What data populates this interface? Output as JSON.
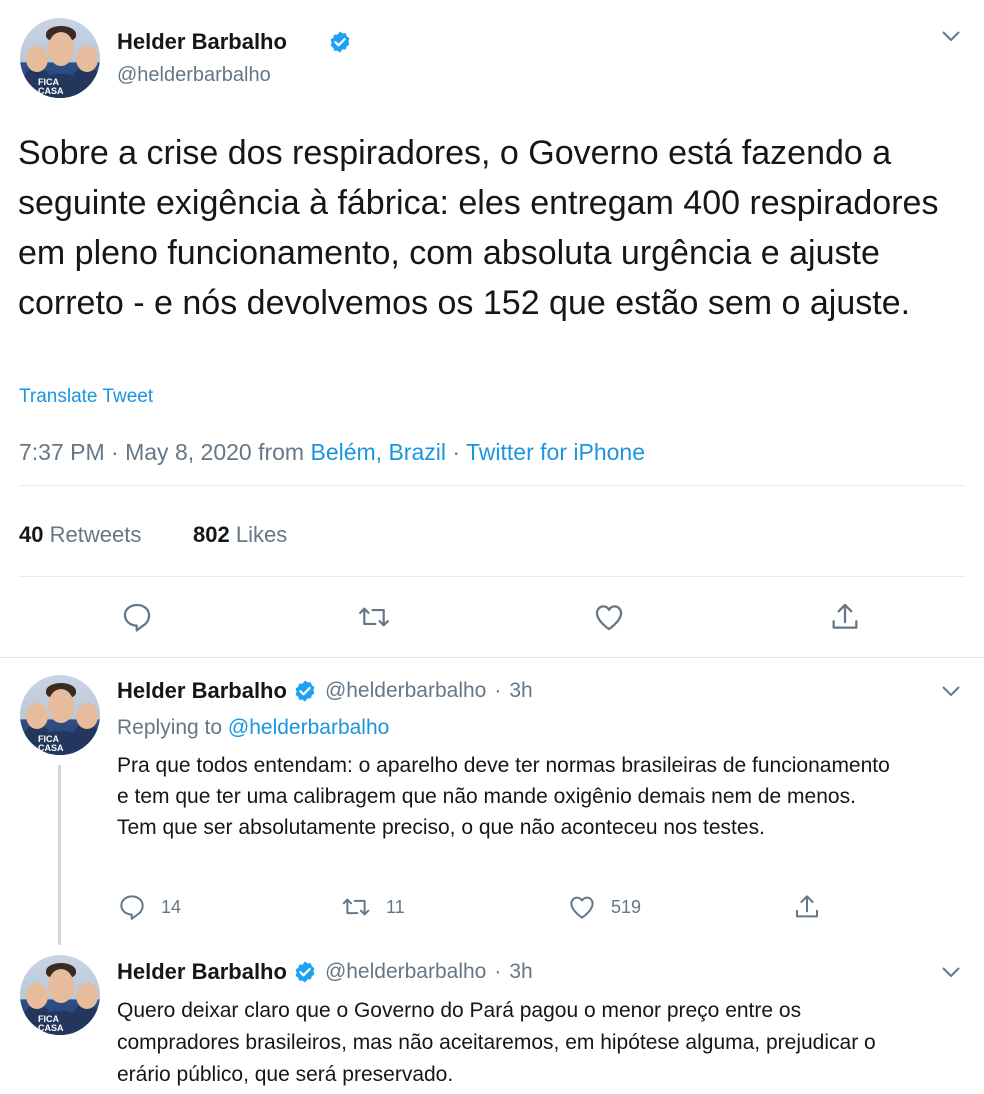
{
  "main_tweet": {
    "author_name": "Helder Barbalho",
    "author_handle": "@helderbarbalho",
    "avatar_text": "FICA CASA",
    "text": "Sobre a crise dos respiradores, o Governo está fazendo a seguinte exigência à fábrica: eles entregam 400 respiradores em pleno funcionamento, com absoluta urgência e ajuste correto - e nós devolvemos os 152 que estão sem o ajuste.",
    "translate_label": "Translate Tweet",
    "time": "7:37 PM",
    "sep1": "·",
    "date": "May 8, 2020",
    "from_label": "from",
    "location": "Belém, Brazil",
    "sep2": "·",
    "source": "Twitter for iPhone",
    "retweets_count": "40",
    "retweets_label": "Retweets",
    "likes_count": "802",
    "likes_label": "Likes"
  },
  "replies": [
    {
      "author_name": "Helder Barbalho",
      "author_handle": "@helderbarbalho",
      "sep": "·",
      "time": "3h",
      "replying_label": "Replying to",
      "replying_handle": "@helderbarbalho",
      "text": "Pra que todos entendam: o aparelho deve ter normas brasileiras de funcionamento e tem que ter uma calibragem que não mande oxigênio demais nem de menos. Tem que ser absolutamente preciso, o que não aconteceu nos testes.",
      "reply_count": "14",
      "retweet_count": "11",
      "like_count": "519"
    },
    {
      "author_name": "Helder Barbalho",
      "author_handle": "@helderbarbalho",
      "sep": "·",
      "time": "3h",
      "text": "Quero deixar claro que o Governo do Pará pagou o menor preço entre os compradores brasileiros, mas não aceitaremos, em hipótese alguma, prejudicar o erário público, que será preservado."
    }
  ],
  "icons": [
    "verified-icon",
    "chevron-down-icon",
    "reply-icon",
    "retweet-icon",
    "like-icon",
    "share-icon"
  ],
  "colors": {
    "link": "#1b95e0",
    "secondary": "#657786",
    "text": "#14171a",
    "divider": "#e6ecf0",
    "thread_line": "#ccd6dd"
  }
}
